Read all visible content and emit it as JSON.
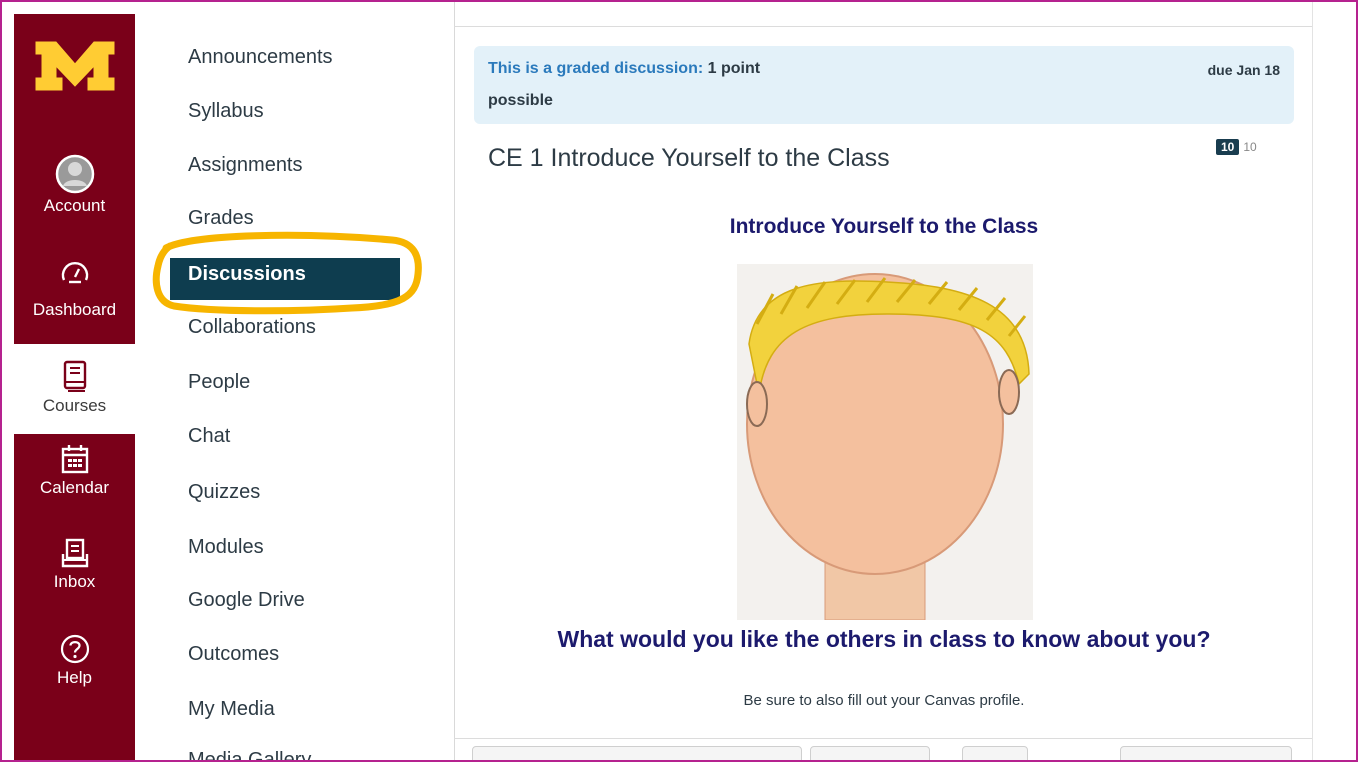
{
  "global_nav": {
    "items": [
      {
        "label": "Account",
        "icon": "avatar-icon"
      },
      {
        "label": "Dashboard",
        "icon": "dashboard-icon"
      },
      {
        "label": "Courses",
        "icon": "book-icon"
      },
      {
        "label": "Calendar",
        "icon": "calendar-icon"
      },
      {
        "label": "Inbox",
        "icon": "inbox-icon"
      },
      {
        "label": "Help",
        "icon": "help-icon"
      }
    ],
    "active": "Courses",
    "colors": {
      "background": "#7a0019",
      "logo": "#ffcc33"
    }
  },
  "course_nav": {
    "items": [
      {
        "label": "Announcements"
      },
      {
        "label": "Syllabus"
      },
      {
        "label": "Assignments"
      },
      {
        "label": "Grades"
      },
      {
        "label": "Discussions"
      },
      {
        "label": "Collaborations"
      },
      {
        "label": "People"
      },
      {
        "label": "Chat"
      },
      {
        "label": "Quizzes"
      },
      {
        "label": "Modules"
      },
      {
        "label": "Google Drive"
      },
      {
        "label": "Outcomes"
      },
      {
        "label": "My Media"
      },
      {
        "label": "Media Gallery"
      }
    ],
    "active": "Discussions",
    "highlight_color": "#f7b500"
  },
  "discussion": {
    "banner_graded": "This is a graded discussion:",
    "banner_points": " 1 point",
    "banner_possible": "possible",
    "due": "due Jan 18",
    "title": "CE 1 Introduce Yourself to the Class",
    "counter_unread": "10",
    "counter_total": "10",
    "heading": "Introduce Yourself to the Class",
    "question": "What would you like the others in class to know about you?",
    "note": "Be sure to also fill out your Canvas profile."
  }
}
